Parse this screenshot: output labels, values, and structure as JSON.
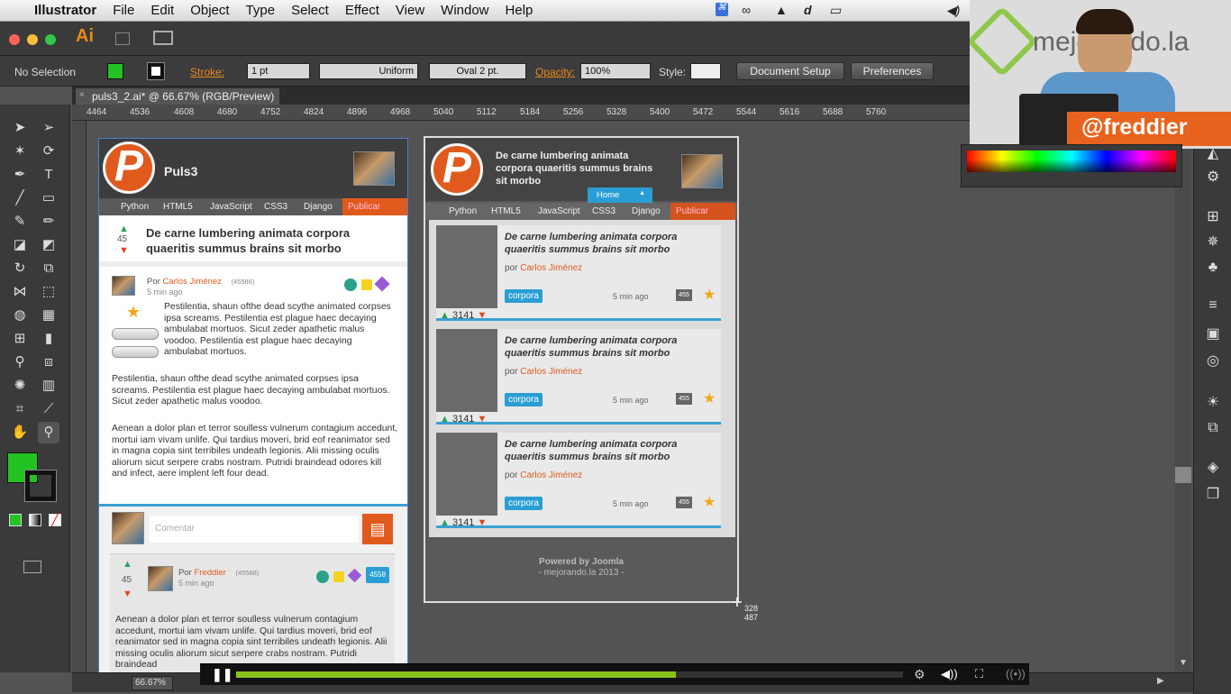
{
  "menubar": {
    "app": "Illustrator",
    "items": [
      "File",
      "Edit",
      "Object",
      "Type",
      "Select",
      "Effect",
      "View",
      "Window",
      "Help"
    ]
  },
  "appbar": {
    "logo": "Ai"
  },
  "control": {
    "selection": "No Selection",
    "stroke_label": "Stroke:",
    "stroke_value": "1 pt",
    "profile": "Uniform",
    "brush": "Oval 2 pt.",
    "opacity_label": "Opacity:",
    "opacity_value": "100%",
    "style_label": "Style:",
    "document_setup": "Document Setup",
    "preferences": "Preferences",
    "fill_color": "#22c322"
  },
  "document": {
    "tab": "puls3_2.ai* @ 66.67% (RGB/Preview)",
    "zoom": "66.67%"
  },
  "ruler": [
    "4464",
    "4536",
    "4608",
    "4680",
    "4752",
    "4824",
    "4896",
    "4968",
    "5040",
    "5112",
    "5184",
    "5256",
    "5328",
    "5400",
    "5472",
    "5544",
    "5616",
    "5688",
    "5760"
  ],
  "webcam": {
    "brand": "mejorando.la",
    "handle": "@freddier"
  },
  "artboard_left": {
    "site_name": "Puls3",
    "nav": [
      "Python",
      "HTML5",
      "JavaScript",
      "CSS3",
      "Django"
    ],
    "publish": "Publicar",
    "article_title": "De carne lumbering animata corpora quaeritis summus brains sit morbo",
    "vote": "45",
    "author_prefix": "Por",
    "author": "Carlos Jiménez",
    "author_id": "(45586)",
    "time": "5 min ago",
    "para1": "Pestilentia, shaun ofthe dead scythe animated corpses ipsa screams. Pestilentia est plague haec decaying ambulabat mortuos. Sicut zeder apathetic malus voodoo. Pestilentia est plague haec decaying ambulabat mortuos.",
    "para2": "Pestilentia, shaun ofthe dead scythe animated corpses ipsa screams. Pestilentia est plague haec decaying ambulabat mortuos. Sicut zeder apathetic malus voodoo.",
    "para3": "Aenean a dolor plan et terror soulless vulnerum contagium accedunt, mortui iam vivam unlife. Qui tardius moveri, brid eof reanimator sed in magna copia sint terribiles undeath legionis. Alii missing oculis aliorum sicut serpere crabs nostram. Putridi braindead odores kill and infect, aere implent left four dead.",
    "comment_placeholder": "Comentar",
    "c_vote": "45",
    "c_author": "Freddier",
    "c_author_id": "(45588)",
    "c_time": "5 min ago",
    "c_badge": "4558",
    "c_para": "Aenean a dolor plan et terror soulless vulnerum contagium accedunt, mortui iam vivam unlife. Qui tardius moveri, brid eof reanimator sed in magna copia sint terribiles undeath legionis. Alii missing oculis aliorum sicut serpere crabs nostram. Putridi braindead"
  },
  "artboard_right": {
    "header_title": "De carne lumbering animata corpora quaeritis summus brains sit morbo",
    "home": "Home",
    "nav": [
      "Python",
      "HTML5",
      "JavaScript",
      "CSS3",
      "Django"
    ],
    "publish": "Publicar",
    "cards": [
      {
        "title": "De carne lumbering animata corpora quaeritis summus brains sit morbo",
        "by": "por",
        "author": "Carlos Jiménez",
        "tag": "corpora",
        "time": "5 min ago",
        "comments": "455",
        "votes": "3141"
      },
      {
        "title": "De carne lumbering animata corpora quaeritis summus brains sit morbo",
        "by": "por",
        "author": "Carlos Jiménez",
        "tag": "corpora",
        "time": "5 min ago",
        "comments": "455",
        "votes": "3141"
      },
      {
        "title": "De carne lumbering animata corpora quaeritis summus brains sit morbo",
        "by": "por",
        "author": "Carlos Jiménez",
        "tag": "corpora",
        "time": "5 min ago",
        "comments": "455",
        "votes": "3141"
      }
    ],
    "footer1": "Powered by Joomla",
    "footer2": "- mejorando.la 2013 -",
    "cursor_x": "328",
    "cursor_y": "487"
  },
  "player": {
    "progress": 0.66
  }
}
